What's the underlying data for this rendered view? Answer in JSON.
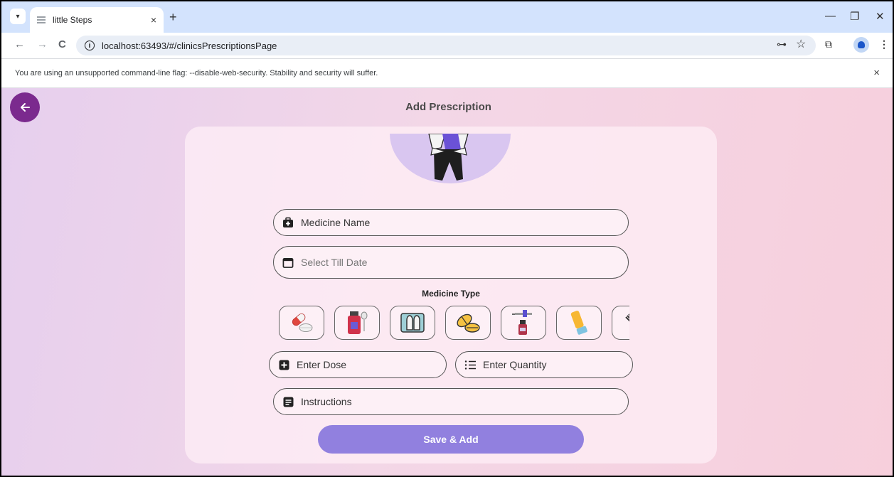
{
  "browser": {
    "tab_title": "little Steps",
    "tab_close": "×",
    "new_tab": "+",
    "url": "localhost:63493/#/clinicsPrescriptionsPage",
    "infobar_message": "You are using an unsupported command-line flag: --disable-web-security. Stability and security will suffer.",
    "infobar_close": "×",
    "icons": {
      "back": "←",
      "forward": "→",
      "reload": "C",
      "key": "⊶",
      "star": "☆",
      "extensions": "⧉",
      "menu": "⋮",
      "minimize": "—",
      "restore": "❐",
      "close": "✕"
    }
  },
  "app": {
    "page_title": "Add Prescription",
    "fields": {
      "medicine_name": "Medicine Name",
      "till_date_placeholder": "Select Till Date",
      "dose": "Enter Dose",
      "quantity": "Enter Quantity",
      "instructions": "Instructions"
    },
    "medicine_type_label": "Medicine Type",
    "medicine_types": [
      "capsule-icon",
      "syrup-icon",
      "suppository-icon",
      "tablets-icon",
      "dropper-icon",
      "inhaler-icon",
      "injection-icon"
    ],
    "save_button": "Save & Add",
    "colors": {
      "back_button": "#7b2a8e",
      "save_button": "#9180df",
      "tab_strip": "#d3e3fd"
    }
  }
}
